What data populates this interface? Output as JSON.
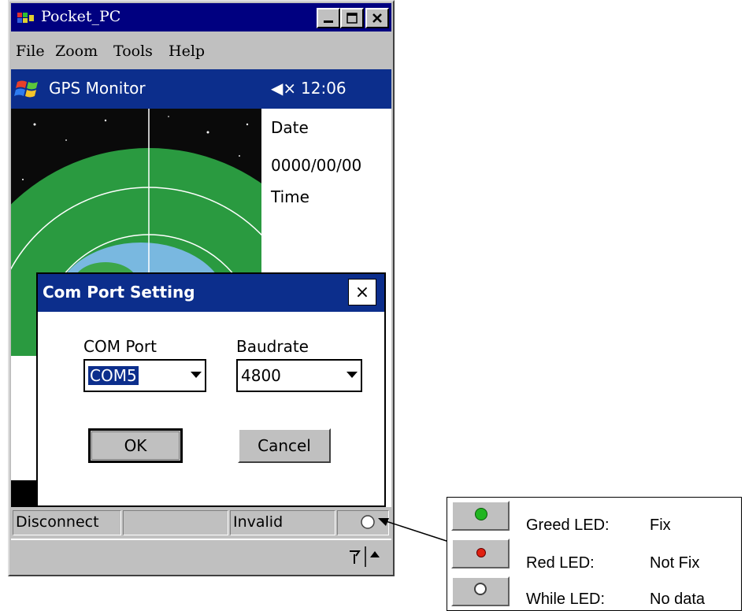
{
  "window": {
    "title": "Pocket_PC",
    "minimize_label": "_",
    "maximize_label": "□",
    "close_label": "×"
  },
  "menu": [
    "File",
    "Zoom",
    "Tools",
    "Help"
  ],
  "device": {
    "app_title": "GPS Monitor",
    "speaker": "◀×",
    "clock": "12:06",
    "info": {
      "date_label": "Date",
      "date_value": "0000/00/00",
      "time_label": "Time"
    }
  },
  "dialog": {
    "title": "Com Port Setting",
    "close_label": "×",
    "com_port_label": "COM Port",
    "com_port_value": "COM5",
    "baudrate_label": "Baudrate",
    "baudrate_value": "4800",
    "ok_label": "OK",
    "cancel_label": "Cancel"
  },
  "status": {
    "connection": "Disconnect",
    "panel2": "",
    "fix": "Invalid",
    "led": "white"
  },
  "legend": [
    {
      "led": "Greed LED:",
      "status": "Fix",
      "color": "#21b521"
    },
    {
      "led": "Red LED:",
      "status": "Not Fix",
      "color": "#e02010"
    },
    {
      "led": "While LED:",
      "status": "No data",
      "color": "#ffffff"
    }
  ],
  "colors": {
    "title_bar": "#000080",
    "ppc_header": "#0c2e8c",
    "selection": "#0c2e8c",
    "globe_ocean": "#2a9a40"
  }
}
